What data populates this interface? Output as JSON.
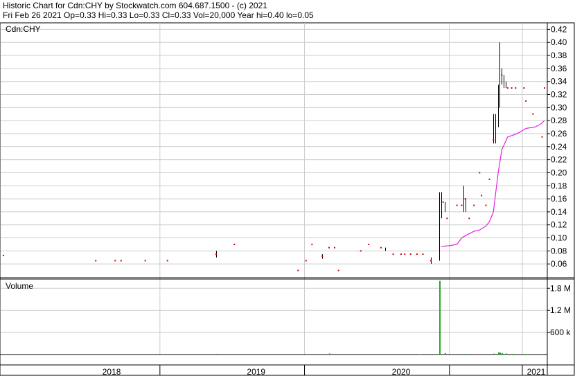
{
  "header": {
    "line1": "Historic Chart for Cdn:CHY by Stockwatch.com 604.687.1500 - (c) 2021",
    "line2": "Fri Feb 26 2021  Op=0.33  Hi=0.33  Lo=0.33  Cl=0.33  Vol=20,000  Year hi=0.40  lo=0.05"
  },
  "colors": {
    "price_bar": "#000000",
    "close_dot": "#cc0000",
    "moving_average": "#e020e0",
    "volume": "#22aa22",
    "grid": "#cccccc",
    "frame": "#000000"
  },
  "chart_data": [
    {
      "type": "scatter",
      "title": "Cdn:CHY",
      "ylim": [
        0.04,
        0.43
      ],
      "yticks": [
        "0.42",
        "0.40",
        "0.38",
        "0.36",
        "0.34",
        "0.32",
        "0.30",
        "0.28",
        "0.26",
        "0.24",
        "0.22",
        "0.20",
        "0.18",
        "0.16",
        "0.14",
        "0.12",
        "0.10",
        "0.08",
        "0.06"
      ],
      "ytick_values": [
        0.42,
        0.4,
        0.38,
        0.36,
        0.34,
        0.32,
        0.3,
        0.28,
        0.26,
        0.24,
        0.22,
        0.2,
        0.18,
        0.16,
        0.14,
        0.12,
        0.1,
        0.08,
        0.06
      ],
      "grid": true,
      "closes": [
        {
          "x": "2017-06-01",
          "y": 0.073
        },
        {
          "x": "2018-01-20",
          "y": 0.065
        },
        {
          "x": "2018-03-10",
          "y": 0.065
        },
        {
          "x": "2018-03-25",
          "y": 0.065
        },
        {
          "x": "2018-05-25",
          "y": 0.065
        },
        {
          "x": "2018-07-20",
          "y": 0.065
        },
        {
          "x": "2018-11-20",
          "y": 0.075
        },
        {
          "x": "2019-01-05",
          "y": 0.09
        },
        {
          "x": "2019-06-15",
          "y": 0.05
        },
        {
          "x": "2019-07-05",
          "y": 0.065
        },
        {
          "x": "2019-07-20",
          "y": 0.09
        },
        {
          "x": "2019-08-15",
          "y": 0.072
        },
        {
          "x": "2019-09-01",
          "y": 0.085
        },
        {
          "x": "2019-09-15",
          "y": 0.085
        },
        {
          "x": "2019-09-25",
          "y": 0.05
        },
        {
          "x": "2019-11-20",
          "y": 0.08
        },
        {
          "x": "2019-12-10",
          "y": 0.09
        },
        {
          "x": "2020-01-10",
          "y": 0.085
        },
        {
          "x": "2020-02-10",
          "y": 0.075
        },
        {
          "x": "2020-03-01",
          "y": 0.075
        },
        {
          "x": "2020-03-10",
          "y": 0.075
        },
        {
          "x": "2020-03-25",
          "y": 0.075
        },
        {
          "x": "2020-04-10",
          "y": 0.075
        },
        {
          "x": "2020-04-25",
          "y": 0.075
        },
        {
          "x": "2020-05-15",
          "y": 0.065
        },
        {
          "x": "2020-06-15",
          "y": 0.155
        },
        {
          "x": "2020-06-25",
          "y": 0.13
        },
        {
          "x": "2020-07-20",
          "y": 0.15
        },
        {
          "x": "2020-08-01",
          "y": 0.15
        },
        {
          "x": "2020-08-10",
          "y": 0.16
        },
        {
          "x": "2020-08-20",
          "y": 0.13
        },
        {
          "x": "2020-09-01",
          "y": 0.15
        },
        {
          "x": "2020-09-15",
          "y": 0.2
        },
        {
          "x": "2020-09-20",
          "y": 0.165
        },
        {
          "x": "2020-10-01",
          "y": 0.15
        },
        {
          "x": "2020-10-10",
          "y": 0.19
        },
        {
          "x": "2020-10-20",
          "y": 0.25
        },
        {
          "x": "2020-11-10",
          "y": 0.35
        },
        {
          "x": "2020-11-25",
          "y": 0.33
        },
        {
          "x": "2020-12-05",
          "y": 0.33
        },
        {
          "x": "2020-12-15",
          "y": 0.33
        },
        {
          "x": "2021-01-05",
          "y": 0.33
        },
        {
          "x": "2021-01-10",
          "y": 0.31
        },
        {
          "x": "2021-01-28",
          "y": 0.29
        },
        {
          "x": "2021-02-20",
          "y": 0.255
        },
        {
          "x": "2021-02-26",
          "y": 0.33
        }
      ],
      "ranges": [
        {
          "x": "2018-11-20",
          "low": 0.07,
          "high": 0.08
        },
        {
          "x": "2019-08-15",
          "low": 0.068,
          "high": 0.075
        },
        {
          "x": "2020-01-20",
          "low": 0.08,
          "high": 0.085
        },
        {
          "x": "2020-05-15",
          "low": 0.06,
          "high": 0.07
        },
        {
          "x": "2020-06-05",
          "low": 0.065,
          "high": 0.17
        },
        {
          "x": "2020-06-10",
          "low": 0.13,
          "high": 0.17
        },
        {
          "x": "2020-06-20",
          "low": 0.14,
          "high": 0.155
        },
        {
          "x": "2020-08-05",
          "low": 0.14,
          "high": 0.18
        },
        {
          "x": "2020-08-10",
          "low": 0.14,
          "high": 0.16
        },
        {
          "x": "2020-10-20",
          "low": 0.245,
          "high": 0.29
        },
        {
          "x": "2020-10-25",
          "low": 0.245,
          "high": 0.29
        },
        {
          "x": "2020-11-01",
          "low": 0.27,
          "high": 0.335
        },
        {
          "x": "2020-11-05",
          "low": 0.3,
          "high": 0.4
        },
        {
          "x": "2020-11-10",
          "low": 0.335,
          "high": 0.36
        },
        {
          "x": "2020-11-15",
          "low": 0.33,
          "high": 0.35
        },
        {
          "x": "2020-11-20",
          "low": 0.33,
          "high": 0.34
        }
      ],
      "moving_average": [
        {
          "x": "2020-06-10",
          "y": 0.087
        },
        {
          "x": "2020-07-01",
          "y": 0.088
        },
        {
          "x": "2020-07-20",
          "y": 0.09
        },
        {
          "x": "2020-08-01",
          "y": 0.1
        },
        {
          "x": "2020-08-15",
          "y": 0.105
        },
        {
          "x": "2020-09-01",
          "y": 0.11
        },
        {
          "x": "2020-09-15",
          "y": 0.112
        },
        {
          "x": "2020-10-01",
          "y": 0.118
        },
        {
          "x": "2020-10-10",
          "y": 0.125
        },
        {
          "x": "2020-10-20",
          "y": 0.14
        },
        {
          "x": "2020-11-01",
          "y": 0.2
        },
        {
          "x": "2020-11-10",
          "y": 0.235
        },
        {
          "x": "2020-11-25",
          "y": 0.255
        },
        {
          "x": "2020-12-10",
          "y": 0.258
        },
        {
          "x": "2020-12-25",
          "y": 0.262
        },
        {
          "x": "2021-01-10",
          "y": 0.268
        },
        {
          "x": "2021-02-01",
          "y": 0.27
        },
        {
          "x": "2021-02-15",
          "y": 0.274
        },
        {
          "x": "2021-02-26",
          "y": 0.28
        }
      ]
    },
    {
      "type": "bar",
      "title": "Volume",
      "ylim": [
        0,
        2050000
      ],
      "yticks": [
        "1.8 M",
        "1.2 M",
        "600 k"
      ],
      "ytick_values": [
        1800000,
        1200000,
        600000
      ],
      "bars": [
        {
          "x": "2018-11-20",
          "y": 20000
        },
        {
          "x": "2019-09-01",
          "y": 30000
        },
        {
          "x": "2020-04-15",
          "y": 15000
        },
        {
          "x": "2020-06-05",
          "y": 2000000
        },
        {
          "x": "2020-06-20",
          "y": 40000
        },
        {
          "x": "2020-08-05",
          "y": 20000
        },
        {
          "x": "2020-10-20",
          "y": 25000
        },
        {
          "x": "2020-11-01",
          "y": 60000
        },
        {
          "x": "2020-11-05",
          "y": 50000
        },
        {
          "x": "2020-11-10",
          "y": 40000
        },
        {
          "x": "2020-11-20",
          "y": 30000
        },
        {
          "x": "2020-12-05",
          "y": 20000
        },
        {
          "x": "2021-01-10",
          "y": 15000
        },
        {
          "x": "2021-02-26",
          "y": 20000
        }
      ]
    }
  ],
  "x_axis": {
    "start": "2017-05-25",
    "end": "2021-03-05",
    "labels": [
      {
        "label": "2018",
        "date": "2018-03-01"
      },
      {
        "label": "2019",
        "date": "2019-03-01"
      },
      {
        "label": "2020",
        "date": "2020-03-01"
      },
      {
        "label": "2021",
        "date": "2021-02-05"
      }
    ],
    "year_boundaries": [
      "2018-07-01",
      "2019-07-01",
      "2020-07-01",
      "2021-01-01"
    ]
  }
}
